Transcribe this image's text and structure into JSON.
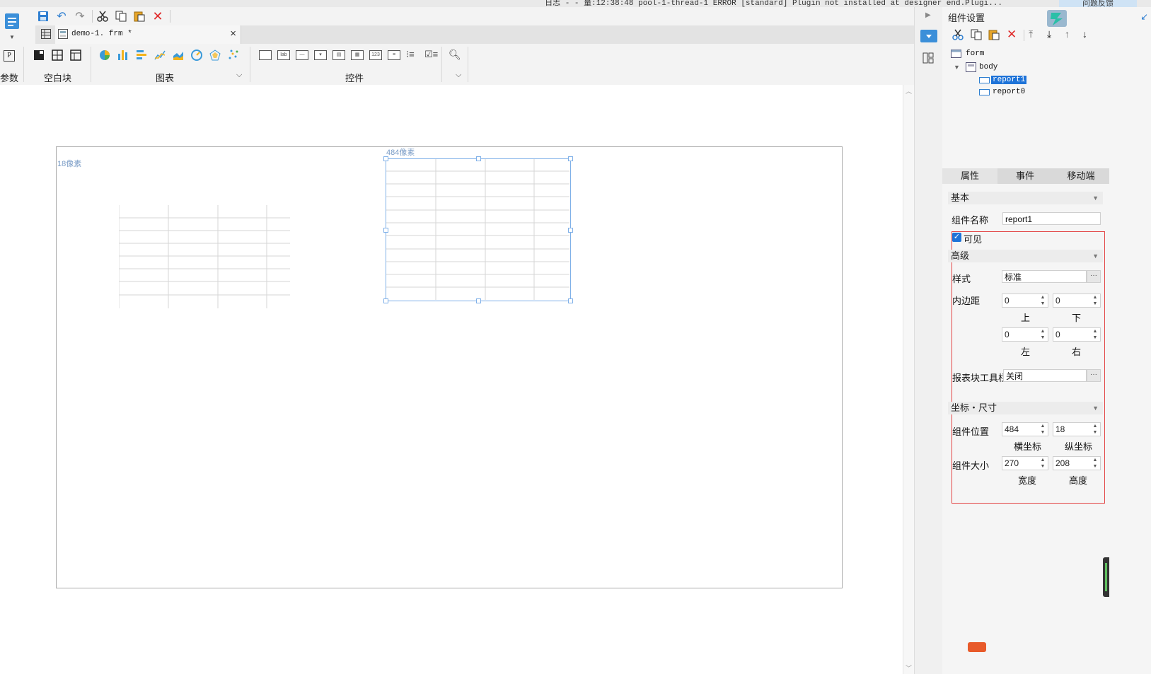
{
  "top_strip": {
    "log_text": "日志 - - 量:12:38:48 pool-1-thread-1 ERROR [standard] Plugin not installed at designer end.Plugi...",
    "feedback": "问题反馈"
  },
  "toolbar": {
    "save_label": "save",
    "undo": "undo",
    "redo": "redo",
    "cut": "cut",
    "copy": "copy",
    "paste": "paste",
    "delete": "delete"
  },
  "tab": {
    "title": "demo-1. frm *",
    "close": "×"
  },
  "ribbon": {
    "param_label": "参数",
    "blank_label": "空白块",
    "chart_label": "图表",
    "widget_label": "控件",
    "expand": "⌵"
  },
  "canvas": {
    "y_label": "18像素",
    "x_label": "484像素"
  },
  "panel": {
    "title": "组件设置",
    "tree": {
      "form": "form",
      "body": "body",
      "report1": "report1",
      "report0": "report0"
    },
    "tabs": [
      "属性",
      "事件",
      "移动端"
    ],
    "basic_section": "基本",
    "name_label": "组件名称",
    "name_value": "report1",
    "visible_label": "可见",
    "advanced_section": "高级",
    "style_label": "样式",
    "style_value": "标准",
    "padding_label": "内边距",
    "padding": {
      "top": "0",
      "bottom": "0",
      "left": "0",
      "right": "0"
    },
    "padding_sub": {
      "top": "上",
      "bottom": "下",
      "left": "左",
      "right": "右"
    },
    "toolbar_label": "报表块工具栏",
    "toolbar_value": "关闭",
    "coord_section": "坐标・尺寸",
    "position_label": "组件位置",
    "pos_x": "484",
    "pos_y": "18",
    "pos_x_sub": "横坐标",
    "pos_y_sub": "纵坐标",
    "size_label": "组件大小",
    "width": "270",
    "height": "208",
    "width_sub": "宽度",
    "height_sub": "高度",
    "more": "···"
  },
  "colors": {
    "accent": "#1e88e5",
    "selection": "#7fb0e8",
    "red_box": "#e34646"
  }
}
